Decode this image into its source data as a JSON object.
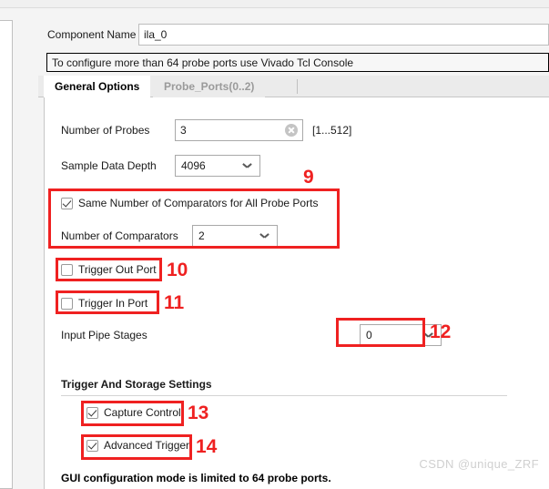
{
  "window": {
    "component_name_label": "Component Name",
    "component_name_value": "ila_0",
    "info_message": "To configure more than 64 probe ports use Vivado Tcl Console"
  },
  "tabs": [
    {
      "label": "General Options",
      "active": true
    },
    {
      "label": "Probe_Ports(0..2)",
      "active": false
    }
  ],
  "general_options": {
    "number_of_probes": {
      "label": "Number of Probes",
      "value": "3",
      "range_hint": "[1...512]",
      "clear_icon": "clear-circle-icon"
    },
    "sample_data_depth": {
      "label": "Sample Data Depth",
      "value": "4096"
    },
    "same_comparators": {
      "label": "Same Number of Comparators for All Probe Ports",
      "checked": true
    },
    "number_of_comparators": {
      "label": "Number of Comparators",
      "value": "2"
    },
    "trigger_out_port": {
      "label": "Trigger Out Port",
      "checked": false
    },
    "trigger_in_port": {
      "label": "Trigger In Port",
      "checked": false
    },
    "input_pipe_stages": {
      "label": "Input Pipe Stages",
      "value": "0"
    },
    "trigger_storage_section": {
      "title": "Trigger And Storage Settings",
      "capture_control": {
        "label": "Capture Control",
        "checked": true
      },
      "advanced_trigger": {
        "label": "Advanced Trigger",
        "checked": true
      }
    },
    "footer_note": "GUI configuration mode is limited to 64 probe ports."
  },
  "annotations": [
    {
      "number": "9"
    },
    {
      "number": "10"
    },
    {
      "number": "11"
    },
    {
      "number": "12"
    },
    {
      "number": "13"
    },
    {
      "number": "14"
    }
  ],
  "watermark": "CSDN @unique_ZRF",
  "colors": {
    "annotation_red": "#ef2121",
    "panel_bg": "#f4f4f4",
    "field_bg": "#ffffff"
  }
}
